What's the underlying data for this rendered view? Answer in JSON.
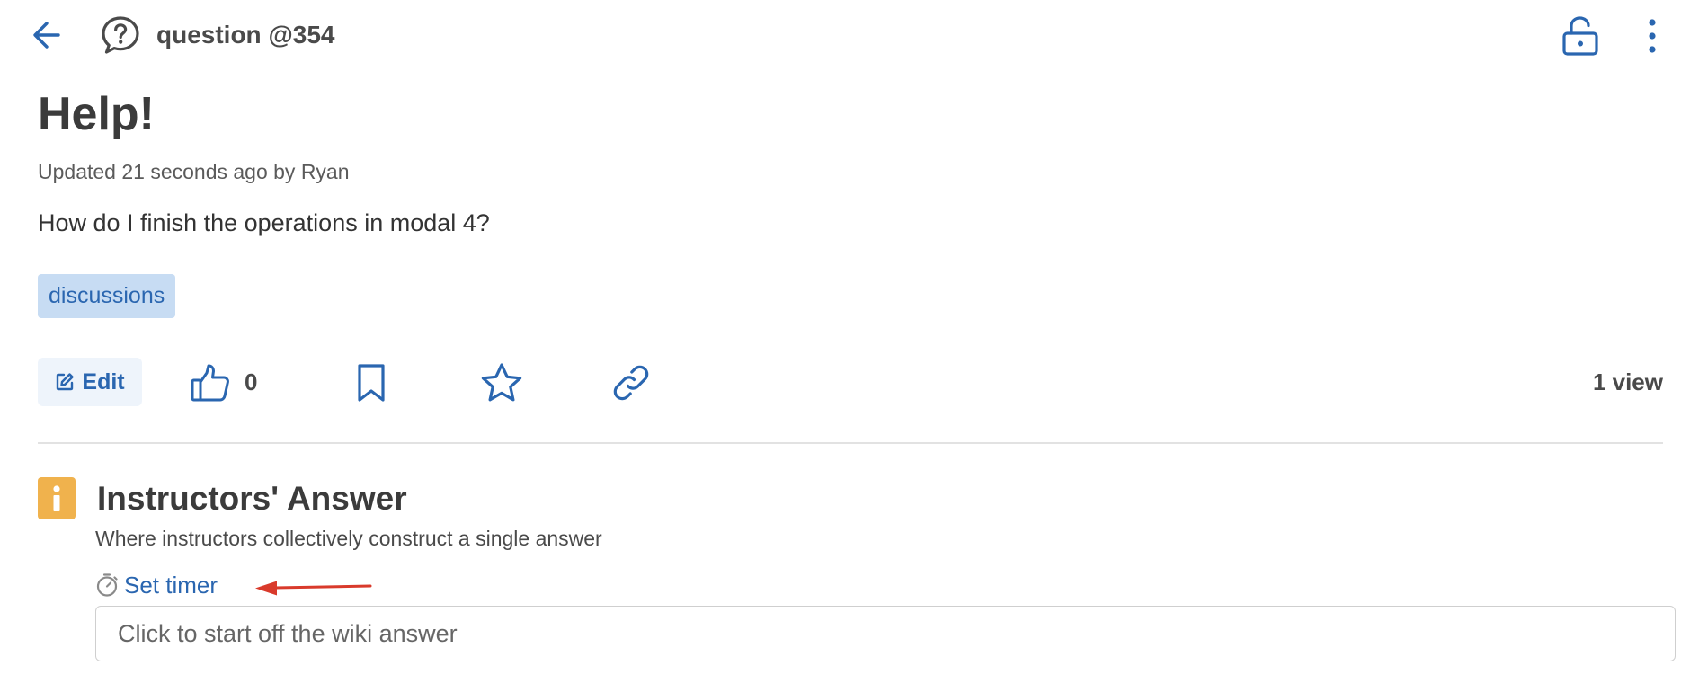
{
  "header": {
    "question_ref": "question @354",
    "icons": {
      "back": "arrow-left-icon",
      "question": "question-bubble-icon",
      "lock": "unlock-icon",
      "more": "kebab-menu-icon"
    }
  },
  "post": {
    "title": "Help!",
    "meta": "Updated 21 seconds ago by Ryan",
    "body": "How do I finish the operations in modal 4?",
    "tags": [
      "discussions"
    ]
  },
  "actions": {
    "edit_label": "Edit",
    "like_count": "0",
    "views": "1 view",
    "icons": {
      "edit": "edit-icon",
      "like": "thumbs-up-icon",
      "bookmark": "bookmark-icon",
      "star": "star-icon",
      "link": "link-icon"
    }
  },
  "instructors_answer": {
    "badge": "i",
    "title": "Instructors' Answer",
    "description": "Where instructors collectively construct a single answer",
    "timer_label": "Set timer",
    "wiki_placeholder": "Click to start off the wiki answer"
  },
  "colors": {
    "accent": "#2a66b0",
    "tag_bg": "#c7dcf3",
    "badge": "#f0b24d",
    "annotation_arrow": "#d93a2b",
    "text": "#3b3b3b"
  }
}
